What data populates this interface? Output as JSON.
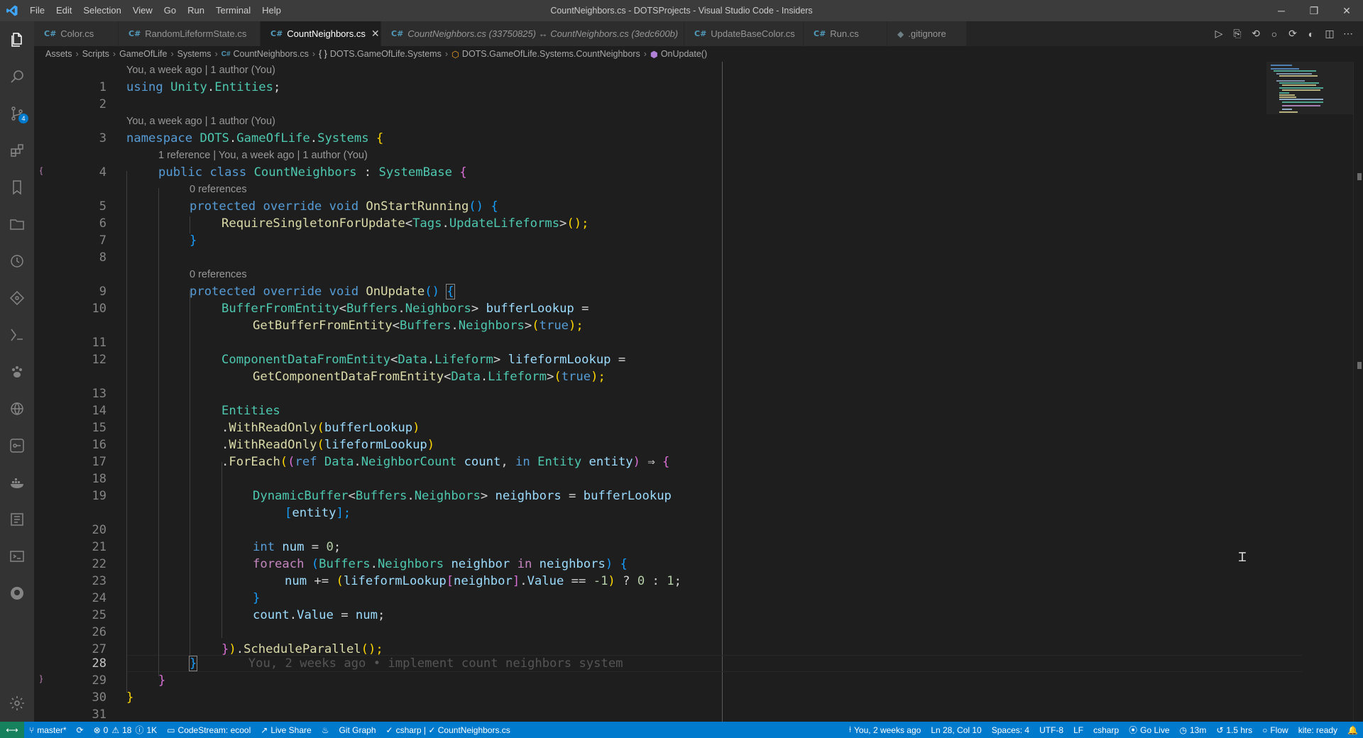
{
  "titlebar": {
    "menu": [
      "File",
      "Edit",
      "Selection",
      "View",
      "Go",
      "Run",
      "Terminal",
      "Help"
    ],
    "title": "CountNeighbors.cs - DOTSProjects - Visual Studio Code - Insiders",
    "minimize": "─",
    "restore": "❐",
    "close": "✕"
  },
  "activity": {
    "scm_badge": "4"
  },
  "tabs": [
    {
      "label": "Color.cs",
      "icon": "C#"
    },
    {
      "label": "RandomLifeformState.cs",
      "icon": "C#"
    },
    {
      "label": "CountNeighbors.cs",
      "icon": "C#",
      "active": true,
      "close": "✕"
    },
    {
      "label": "CountNeighbors.cs (33750825) ↔ CountNeighbors.cs (3edc600b)",
      "icon": "C#"
    },
    {
      "label": "UpdateBaseColor.cs",
      "icon": "C#"
    },
    {
      "label": "Run.cs",
      "icon": "C#"
    },
    {
      "label": ".gitignore",
      "icon": "◆"
    }
  ],
  "tab_actions": [
    "▷",
    "⎘",
    "⟲",
    "○",
    "⟳",
    "◐",
    "◫",
    "⋯"
  ],
  "breadcrumbs": [
    "Assets",
    "Scripts",
    "GameOfLife",
    "Systems",
    "CountNeighbors.cs",
    "DOTS.GameOfLife.Systems",
    "DOTS.GameOfLife.Systems.CountNeighbors",
    "OnUpdate()"
  ],
  "breadcrumb_icons": {
    "file": "C#",
    "namespace": "{ }",
    "class": "⬡",
    "method": "⬢"
  },
  "codelens": {
    "l1": "You, a week ago | 1 author (You)",
    "l3": "You, a week ago | 1 author (You)",
    "l4": "1 reference | You, a week ago | 1 author (You)",
    "l5": "0 references",
    "l9": "0 references"
  },
  "line_numbers": [
    "1",
    "2",
    "3",
    "4",
    "5",
    "6",
    "7",
    "8",
    "9",
    "10",
    "11",
    "12",
    "13",
    "14",
    "15",
    "16",
    "17",
    "18",
    "19",
    "20",
    "21",
    "22",
    "23",
    "24",
    "25",
    "26",
    "27",
    "28",
    "29",
    "30",
    "31"
  ],
  "code": {
    "l1": [
      "using",
      " ",
      "Unity",
      ".",
      "Entities",
      ";"
    ],
    "l3": [
      "namespace",
      " ",
      "DOTS",
      ".",
      "GameOfLife",
      ".",
      "Systems",
      " ",
      "{"
    ],
    "l4": [
      "public",
      " ",
      "class",
      " ",
      "CountNeighbors",
      " : ",
      "SystemBase",
      " ",
      "{"
    ],
    "l5": [
      "protected",
      " ",
      "override",
      " ",
      "void",
      " ",
      "OnStartRunning",
      "()",
      " ",
      "{"
    ],
    "l6": [
      "RequireSingletonForUpdate",
      "<",
      "Tags",
      ".",
      "UpdateLifeforms",
      ">",
      "();"
    ],
    "l7": [
      "}"
    ],
    "l9": [
      "protected",
      " ",
      "override",
      " ",
      "void",
      " ",
      "OnUpdate",
      "()",
      " ",
      "{"
    ],
    "l10": [
      "BufferFromEntity",
      "<",
      "Buffers",
      ".",
      "Neighbors",
      ">",
      " ",
      "bufferLookup",
      " ="
    ],
    "l10b": [
      "GetBufferFromEntity",
      "<",
      "Buffers",
      ".",
      "Neighbors",
      ">",
      "(",
      "true",
      ");"
    ],
    "l12": [
      "ComponentDataFromEntity",
      "<",
      "Data",
      ".",
      "Lifeform",
      ">",
      " ",
      "lifeformLookup",
      " ="
    ],
    "l12b": [
      "GetComponentDataFromEntity",
      "<",
      "Data",
      ".",
      "Lifeform",
      ">",
      "(",
      "true",
      ");"
    ],
    "l14": [
      "Entities"
    ],
    "l15": [
      ".",
      "WithReadOnly",
      "(",
      "bufferLookup",
      ")"
    ],
    "l16": [
      ".",
      "WithReadOnly",
      "(",
      "lifeformLookup",
      ")"
    ],
    "l17": [
      ".",
      "ForEach",
      "(",
      "(",
      "ref",
      " ",
      "Data",
      ".",
      "NeighborCount",
      " ",
      "count",
      ", ",
      "in",
      " ",
      "Entity",
      " ",
      "entity",
      ")",
      " ⇒ ",
      "{"
    ],
    "l19": [
      "DynamicBuffer",
      "<",
      "Buffers",
      ".",
      "Neighbors",
      ">",
      " ",
      "neighbors",
      " = ",
      "bufferLookup"
    ],
    "l19b": [
      "[",
      "entity",
      "];"
    ],
    "l21": [
      "int",
      " ",
      "num",
      " = ",
      "0",
      ";"
    ],
    "l22": [
      "foreach",
      " ",
      "(",
      "Buffers",
      ".",
      "Neighbors",
      " ",
      "neighbor",
      " ",
      "in",
      " ",
      "neighbors",
      ")",
      " ",
      "{"
    ],
    "l23": [
      "num",
      " += ",
      "(",
      "lifeformLookup",
      "[",
      "neighbor",
      "]",
      ".",
      "Value",
      " == ",
      "-1",
      ")",
      " ? ",
      "0",
      " : ",
      "1",
      ";"
    ],
    "l24": [
      "}"
    ],
    "l25": [
      "count",
      ".",
      "Value",
      " = ",
      "num",
      ";"
    ],
    "l27": [
      "}",
      ")",
      ".",
      "ScheduleParallel",
      "();"
    ],
    "l28": [
      "}",
      "You, 2 weeks ago • implement count neighbors system"
    ],
    "l29": [
      "}"
    ],
    "l30": [
      "}"
    ]
  },
  "status": {
    "remote": "⟷",
    "branch": "master*",
    "sync": "⟳",
    "problems": "0",
    "warnings": "18",
    "info": "1K",
    "codestream": "CodeStream: ecool",
    "liveshare": "Live Share",
    "gitgraph": "Git Graph",
    "language_check": "csharp | ✓ CountNeighbors.cs",
    "blame": "You, 2 weeks ago",
    "position": "Ln 28, Col 10",
    "spaces": "Spaces: 4",
    "encoding": "UTF-8",
    "eol": "LF",
    "language": "csharp",
    "golive": "Go Live",
    "time1": "13m",
    "time2": "1.5 hrs",
    "flow": "Flow",
    "kite": "kite: ready",
    "bell": "🔔"
  }
}
